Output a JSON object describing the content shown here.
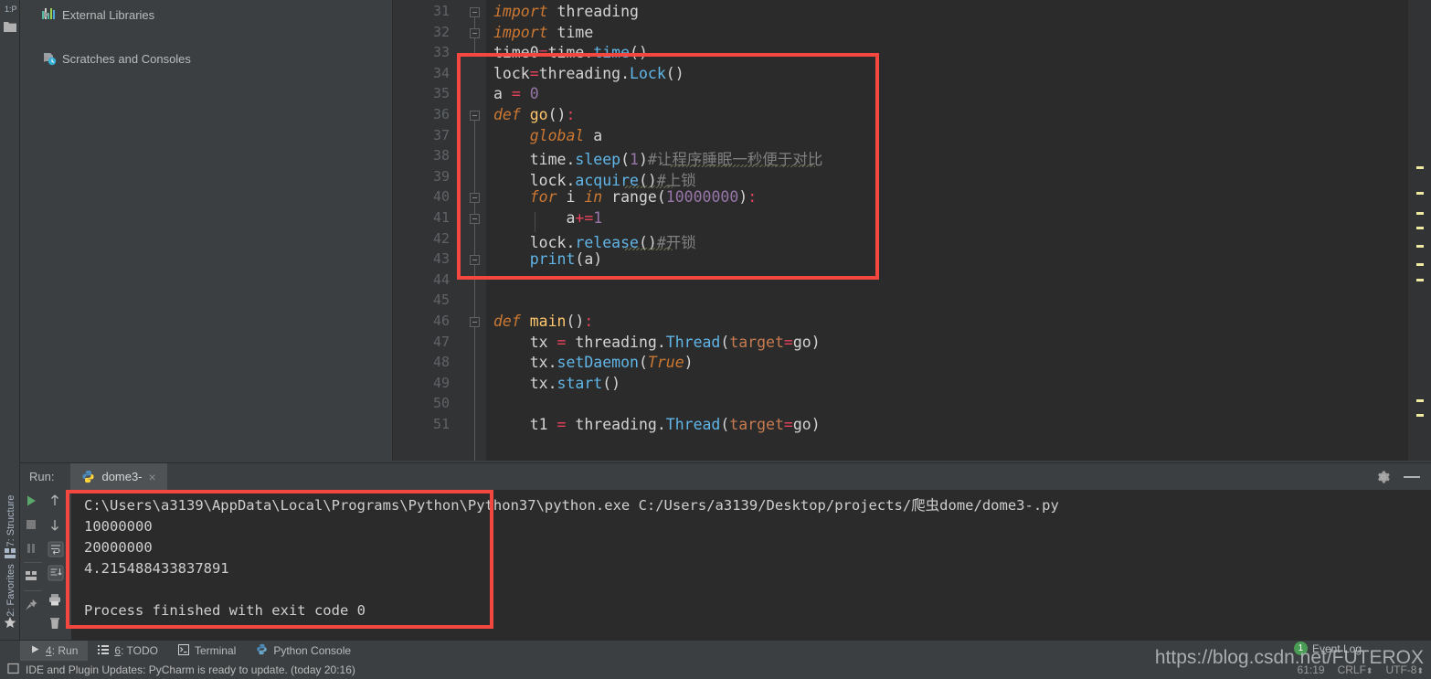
{
  "project_tree": {
    "items": [
      {
        "label": "External Libraries",
        "icon": "library-icon",
        "expanded": false
      },
      {
        "label": "Scratches and Consoles",
        "icon": "scratches-icon",
        "expanded": false
      }
    ]
  },
  "left_strip": {
    "structure_label": "7: Structure",
    "favorites_label": "2: Favorites"
  },
  "editor": {
    "first_line_number": 31,
    "lines": [
      {
        "n": 31,
        "tokens": [
          {
            "t": "import",
            "c": "kw"
          },
          {
            "t": " threading",
            "c": "plain"
          }
        ]
      },
      {
        "n": 32,
        "tokens": [
          {
            "t": "import",
            "c": "kw"
          },
          {
            "t": " time",
            "c": "plain"
          }
        ]
      },
      {
        "n": 33,
        "tokens": [
          {
            "t": "time0",
            "c": "plain"
          },
          {
            "t": "=",
            "c": "op"
          },
          {
            "t": "time.",
            "c": "plain"
          },
          {
            "t": "time",
            "c": "meth"
          },
          {
            "t": "()",
            "c": "plain"
          }
        ]
      },
      {
        "n": 34,
        "tokens": [
          {
            "t": "lock",
            "c": "plain"
          },
          {
            "t": "=",
            "c": "op"
          },
          {
            "t": "threading.",
            "c": "plain"
          },
          {
            "t": "Lock",
            "c": "meth"
          },
          {
            "t": "()",
            "c": "plain"
          }
        ]
      },
      {
        "n": 35,
        "tokens": [
          {
            "t": "a ",
            "c": "plain"
          },
          {
            "t": "=",
            "c": "op"
          },
          {
            "t": " ",
            "c": "plain"
          },
          {
            "t": "0",
            "c": "num"
          }
        ]
      },
      {
        "n": 36,
        "tokens": [
          {
            "t": "def",
            "c": "kw"
          },
          {
            "t": " ",
            "c": "plain"
          },
          {
            "t": "go",
            "c": "fn"
          },
          {
            "t": "()",
            "c": "plain"
          },
          {
            "t": ":",
            "c": "punc"
          }
        ]
      },
      {
        "n": 37,
        "tokens": [
          {
            "t": "    ",
            "c": "plain"
          },
          {
            "t": "global",
            "c": "kw"
          },
          {
            "t": " a",
            "c": "plain"
          }
        ]
      },
      {
        "n": 38,
        "tokens": [
          {
            "t": "    time.",
            "c": "plain"
          },
          {
            "t": "sleep",
            "c": "meth"
          },
          {
            "t": "(",
            "c": "plain"
          },
          {
            "t": "1",
            "c": "num"
          },
          {
            "t": ")",
            "c": "plain"
          },
          {
            "t": "#让程序睡眠一秒便于对比",
            "c": "cmt"
          }
        ]
      },
      {
        "n": 39,
        "tokens": [
          {
            "t": "    lock.",
            "c": "plain"
          },
          {
            "t": "acquire",
            "c": "meth"
          },
          {
            "t": "()",
            "c": "plain"
          },
          {
            "t": "#上锁",
            "c": "cmt"
          }
        ]
      },
      {
        "n": 40,
        "tokens": [
          {
            "t": "    ",
            "c": "plain"
          },
          {
            "t": "for",
            "c": "kw"
          },
          {
            "t": " i ",
            "c": "plain"
          },
          {
            "t": "in",
            "c": "kw"
          },
          {
            "t": " range(",
            "c": "plain"
          },
          {
            "t": "10000000",
            "c": "num"
          },
          {
            "t": ")",
            "c": "plain"
          },
          {
            "t": ":",
            "c": "punc"
          }
        ]
      },
      {
        "n": 41,
        "tokens": [
          {
            "t": "        a",
            "c": "plain"
          },
          {
            "t": "+=",
            "c": "op"
          },
          {
            "t": "1",
            "c": "num"
          }
        ]
      },
      {
        "n": 42,
        "tokens": [
          {
            "t": "    lock.",
            "c": "plain"
          },
          {
            "t": "release",
            "c": "meth"
          },
          {
            "t": "()",
            "c": "plain"
          },
          {
            "t": "#开锁",
            "c": "cmt"
          }
        ]
      },
      {
        "n": 43,
        "tokens": [
          {
            "t": "    ",
            "c": "plain"
          },
          {
            "t": "print",
            "c": "meth"
          },
          {
            "t": "(a)",
            "c": "plain"
          }
        ]
      },
      {
        "n": 44,
        "tokens": []
      },
      {
        "n": 45,
        "tokens": []
      },
      {
        "n": 46,
        "tokens": [
          {
            "t": "def",
            "c": "kw"
          },
          {
            "t": " ",
            "c": "plain"
          },
          {
            "t": "main",
            "c": "fn"
          },
          {
            "t": "()",
            "c": "plain"
          },
          {
            "t": ":",
            "c": "punc"
          }
        ]
      },
      {
        "n": 47,
        "tokens": [
          {
            "t": "    tx ",
            "c": "plain"
          },
          {
            "t": "=",
            "c": "op"
          },
          {
            "t": " threading.",
            "c": "plain"
          },
          {
            "t": "Thread",
            "c": "meth"
          },
          {
            "t": "(",
            "c": "plain"
          },
          {
            "t": "target",
            "c": "param"
          },
          {
            "t": "=",
            "c": "op"
          },
          {
            "t": "go)",
            "c": "plain"
          }
        ]
      },
      {
        "n": 48,
        "tokens": [
          {
            "t": "    tx.",
            "c": "plain"
          },
          {
            "t": "setDaemon",
            "c": "meth"
          },
          {
            "t": "(",
            "c": "plain"
          },
          {
            "t": "True",
            "c": "kw"
          },
          {
            "t": ")",
            "c": "plain"
          }
        ]
      },
      {
        "n": 49,
        "tokens": [
          {
            "t": "    tx.",
            "c": "plain"
          },
          {
            "t": "start",
            "c": "meth"
          },
          {
            "t": "()",
            "c": "plain"
          }
        ]
      },
      {
        "n": 50,
        "tokens": []
      },
      {
        "n": 51,
        "tokens": [
          {
            "t": "    t1 ",
            "c": "plain"
          },
          {
            "t": "=",
            "c": "op"
          },
          {
            "t": " threading.",
            "c": "plain"
          },
          {
            "t": "Thread",
            "c": "meth"
          },
          {
            "t": "(",
            "c": "plain"
          },
          {
            "t": "target",
            "c": "param"
          },
          {
            "t": "=",
            "c": "op"
          },
          {
            "t": "go)",
            "c": "plain"
          }
        ]
      }
    ]
  },
  "run_panel": {
    "run_label": "Run:",
    "tab_title": "dome3-",
    "tab_close": "×",
    "console_lines": [
      "C:\\Users\\a3139\\AppData\\Local\\Programs\\Python\\Python37\\python.exe C:/Users/a3139/Desktop/projects/爬虫dome/dome3-.py",
      "10000000",
      "20000000",
      "4.215488433837891",
      "",
      "Process finished with exit code 0"
    ]
  },
  "tool_windows": [
    {
      "num": "4",
      "label": ": Run",
      "icon": "play-icon",
      "active": true
    },
    {
      "num": "6",
      "label": ": TODO",
      "icon": "todo-icon",
      "active": false
    },
    {
      "num": "",
      "label": "Terminal",
      "icon": "terminal-icon",
      "active": false
    },
    {
      "num": "",
      "label": "Python Console",
      "icon": "python-console-icon",
      "active": false
    }
  ],
  "status_bar": {
    "message": "IDE and Plugin Updates: PyCharm is ready to update. (today 20:16)",
    "caret_position": "61:19",
    "line_separator": "CRLF",
    "encoding": "UTF-8"
  },
  "event_log": {
    "count": "1",
    "label": "Event Log"
  },
  "watermark": {
    "text": "https://blog.csdn.net/FUTEROX"
  },
  "colors": {
    "annotation_red": "#f4473f",
    "editor_bg": "#2b2b2b",
    "panel_bg": "#3c3f41",
    "gutter_bg": "#313335",
    "badge_green": "#499c54",
    "marker_yellow": "#f2e9a0"
  }
}
